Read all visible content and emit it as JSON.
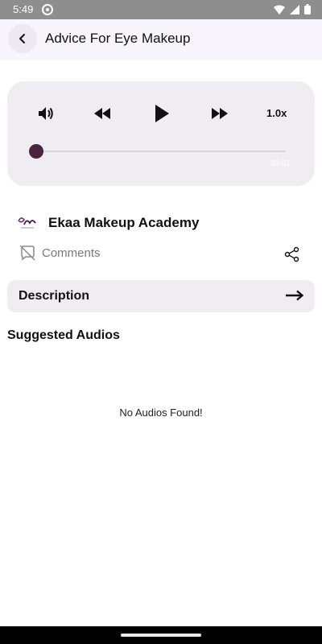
{
  "status_bar": {
    "time": "5:49",
    "time_icon": "sync-icon",
    "icons": [
      "wifi-icon",
      "signal-icon",
      "battery-icon"
    ]
  },
  "app_bar": {
    "back_icon": "chevron-left-icon",
    "title": "Advice For Eye Makeup"
  },
  "player": {
    "speed_label": "1.0x",
    "duration": "33:01",
    "progress": 0.0,
    "controls": [
      "volume-icon",
      "rewind-icon",
      "play-icon",
      "fast-forward-icon"
    ]
  },
  "channel": {
    "name": "Ekaa Makeup Academy",
    "logo_icon": "channel-logo"
  },
  "comments": {
    "label": "Comments",
    "icon": "comments-disabled-icon"
  },
  "share": {
    "icon": "share-icon"
  },
  "description": {
    "label": "Description",
    "arrow_icon": "arrow-right-icon"
  },
  "suggested": {
    "title": "Suggested Audios",
    "empty_message": "No Audios Found!"
  },
  "colors": {
    "accent": "#4b2440",
    "panel": "#efedf1",
    "appbar": "#f8f6fc"
  }
}
